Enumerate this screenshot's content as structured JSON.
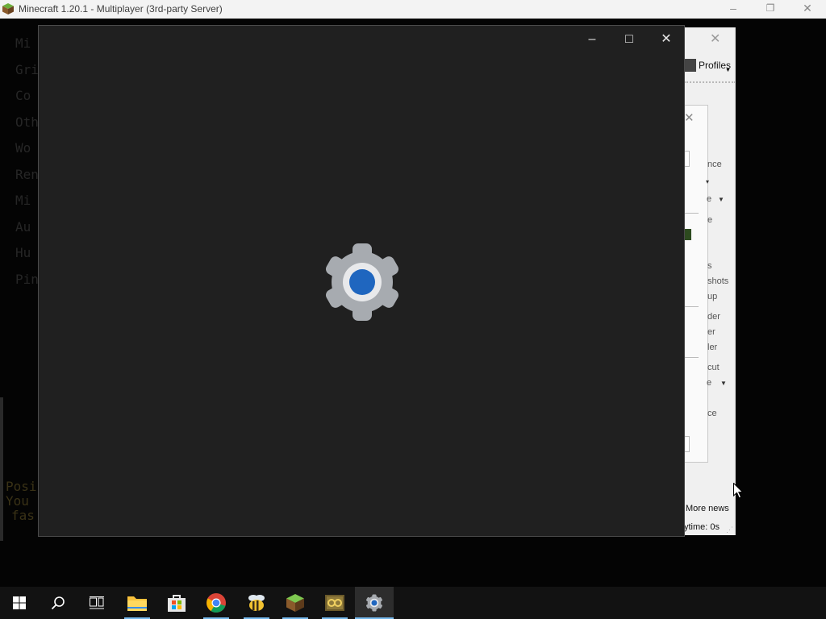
{
  "minecraft": {
    "title": "Minecraft 1.20.1 - Multiplayer (3rd-party Server)",
    "minimize": "–",
    "restore": "❐",
    "close": "✕",
    "menu_items": [
      "Mi",
      "Gri",
      "Co",
      "Oth",
      "Wo",
      "Ren",
      "Mi",
      "Au",
      "Hu",
      "Pin"
    ],
    "position_lines": [
      "Posi",
      "You",
      "fas"
    ]
  },
  "launcher": {
    "close": "✕",
    "profiles_label": "Profiles",
    "panel_close": "✕",
    "panel_texts": [
      "nce",
      "e",
      "e",
      "s",
      "shots",
      "up",
      "der",
      "er",
      "ler",
      "cut",
      "e",
      "ce"
    ],
    "more_news": "More news",
    "playtime": "ytime: 0s"
  },
  "settings": {
    "title": "",
    "minimize": "–",
    "maximize": "□",
    "close": "✕",
    "accent": "#1f66bf",
    "gear_color": "#a7abb0"
  },
  "taskbar": {
    "items": [
      "start",
      "search",
      "task-view",
      "file-explorer",
      "microsoft-store",
      "chrome",
      "bee-app",
      "minecraft-launcher",
      "game-app",
      "settings"
    ],
    "active": "settings"
  }
}
